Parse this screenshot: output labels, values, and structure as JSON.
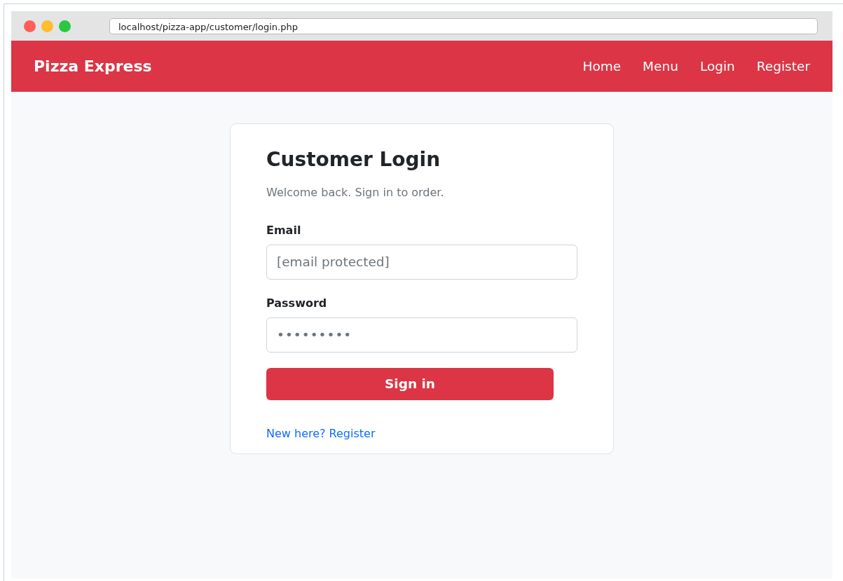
{
  "browser": {
    "url": "localhost/pizza-app/customer/login.php"
  },
  "navbar": {
    "brand": "Pizza Express",
    "links": [
      {
        "label": "Home"
      },
      {
        "label": "Menu"
      },
      {
        "label": "Login"
      },
      {
        "label": "Register"
      }
    ]
  },
  "login_card": {
    "title": "Customer Login",
    "subtitle": "Welcome back. Sign in to order.",
    "fields": [
      {
        "label": "Email",
        "kind": "email",
        "placeholder": "[email protected]"
      },
      {
        "label": "Password",
        "kind": "password",
        "placeholder": "•••••••••"
      }
    ],
    "submit": "Sign in",
    "register_link": "New here? Register"
  }
}
